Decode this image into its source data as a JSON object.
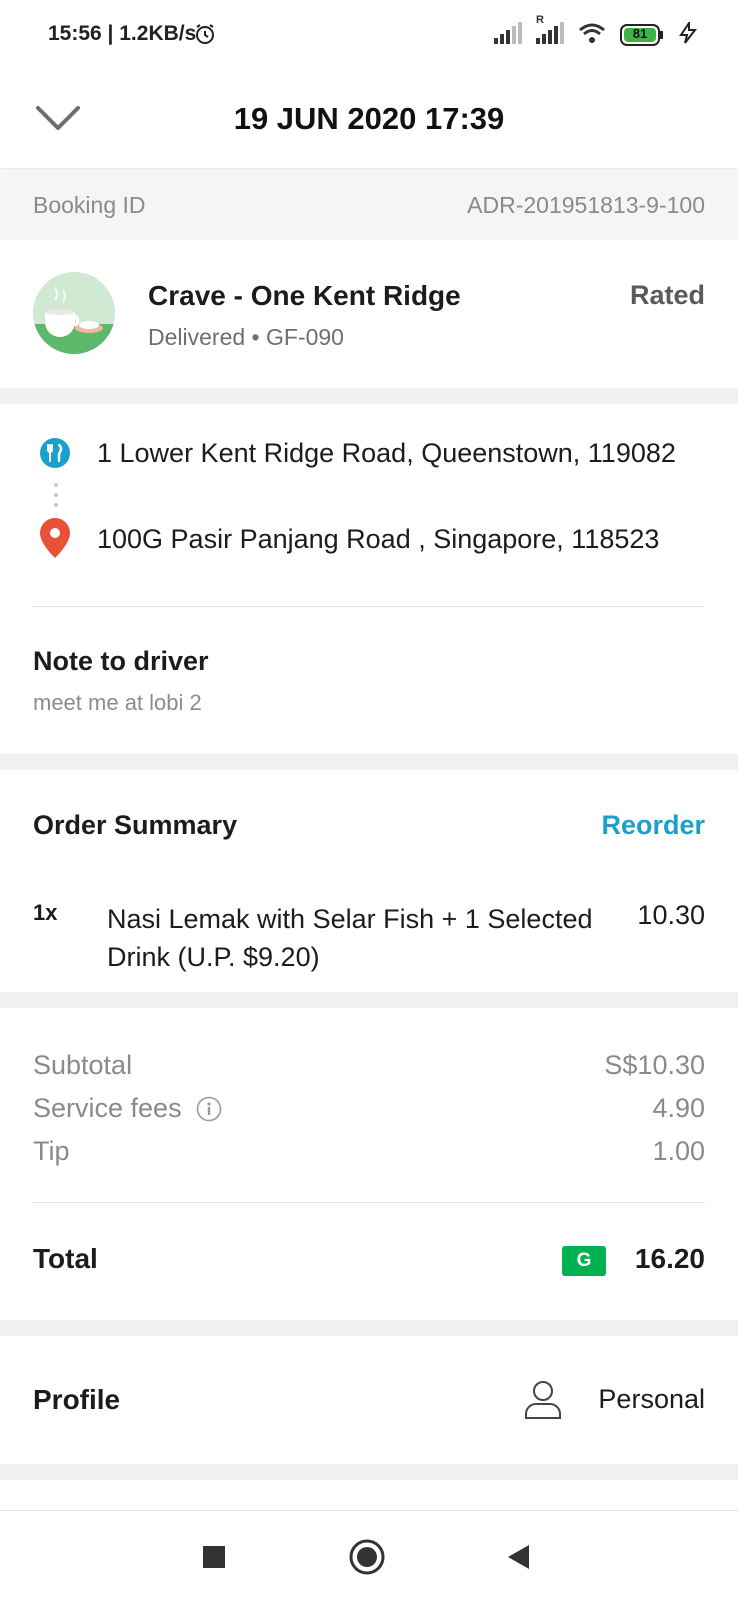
{
  "status_bar": {
    "time": "15:56 | 1.2KB/s",
    "battery": "81",
    "roaming": "R"
  },
  "header": {
    "title": "19 JUN 2020 17:39"
  },
  "booking": {
    "label": "Booking ID",
    "value": "ADR-201951813-9-100"
  },
  "merchant": {
    "name": "Crave - One Kent Ridge",
    "status": "Delivered • GF-090",
    "rating_status": "Rated"
  },
  "addresses": {
    "pickup": "1 Lower Kent Ridge Road, Queenstown, 119082",
    "dropoff": "100G Pasir Panjang Road , Singapore, 118523"
  },
  "note": {
    "title": "Note to driver",
    "text": "meet me at lobi 2"
  },
  "order": {
    "title": "Order Summary",
    "reorder_label": "Reorder",
    "items": [
      {
        "qty": "1x",
        "name": "Nasi Lemak with Selar Fish + 1 Selected Drink (U.P. $9.20)",
        "price": "10.30"
      }
    ]
  },
  "totals": {
    "subtotal_label": "Subtotal",
    "subtotal_value": "S$10.30",
    "service_label": "Service fees",
    "service_value": "4.90",
    "tip_label": "Tip",
    "tip_value": "1.00",
    "total_label": "Total",
    "total_badge": "G",
    "total_value": "16.20"
  },
  "profile": {
    "title": "Profile",
    "value": "Personal"
  },
  "colors": {
    "accent": "#1ba0cc",
    "grab_green": "#00b14f",
    "pin_red": "#e8503a"
  }
}
